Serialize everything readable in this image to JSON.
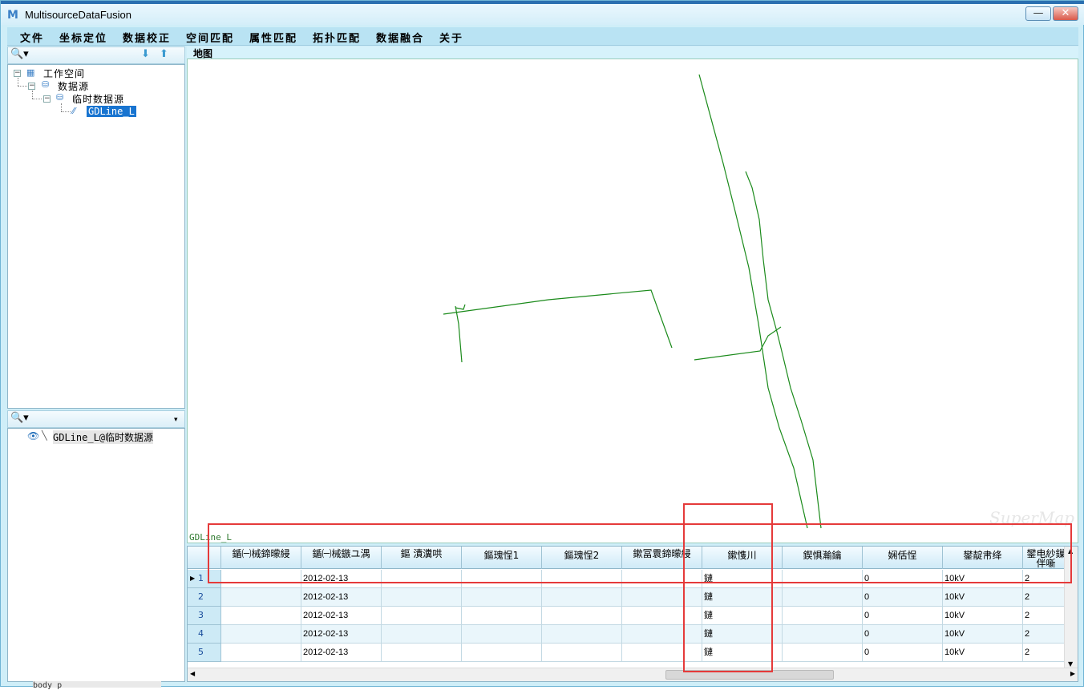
{
  "app": {
    "title": "MultisourceDataFusion",
    "icon_glyph": "M"
  },
  "window_controls": {
    "minimize": "—",
    "close": "✕"
  },
  "menu": [
    "文件",
    "坐标定位",
    "数据校正",
    "空间匹配",
    "属性匹配",
    "拓扑匹配",
    "数据融合",
    "关于"
  ],
  "workspace_tree": {
    "root": "工作空间",
    "datasources": "数据源",
    "temp_datasource": "临时数据源",
    "dataset": "GDLine_L"
  },
  "layers": {
    "item": "GDLine_L@临时数据源"
  },
  "map": {
    "tab_label": "地图",
    "layer_label": "GDLine_L",
    "watermark": "SuperMap",
    "line_color": "#1a8a1a"
  },
  "grid": {
    "columns": [
      "鍎㈠械鍗曚綅",
      "鍎㈠械鏃ユ湡",
      "鏂 漬瀵哄",
      "鏂瑰悜1",
      "鏂瑰悜2",
      "鏉冨睘鍗曚綅",
      "鏉愯川",
      "鍥惧瀭鑰",
      "娴佸悜",
      "鐢靛帇绛",
      "鐢电紗鏁伴噺"
    ],
    "rows": [
      {
        "num": "1",
        "date": "2012-02-13",
        "material": "鏈",
        "v1": "0",
        "voltage": "10kV",
        "count": "2"
      },
      {
        "num": "2",
        "date": "2012-02-13",
        "material": "鏈",
        "v1": "0",
        "voltage": "10kV",
        "count": "2"
      },
      {
        "num": "3",
        "date": "2012-02-13",
        "material": "鏈",
        "v1": "0",
        "voltage": "10kV",
        "count": "2"
      },
      {
        "num": "4",
        "date": "2012-02-13",
        "material": "鏈",
        "v1": "0",
        "voltage": "10kV",
        "count": "2"
      },
      {
        "num": "5",
        "date": "2012-02-13",
        "material": "鏈",
        "v1": "0",
        "voltage": "10kV",
        "count": "2"
      }
    ]
  },
  "colors": {
    "highlight_box": "#e53a3a",
    "selection": "#1874d0"
  },
  "footer": {
    "text": "body p"
  }
}
